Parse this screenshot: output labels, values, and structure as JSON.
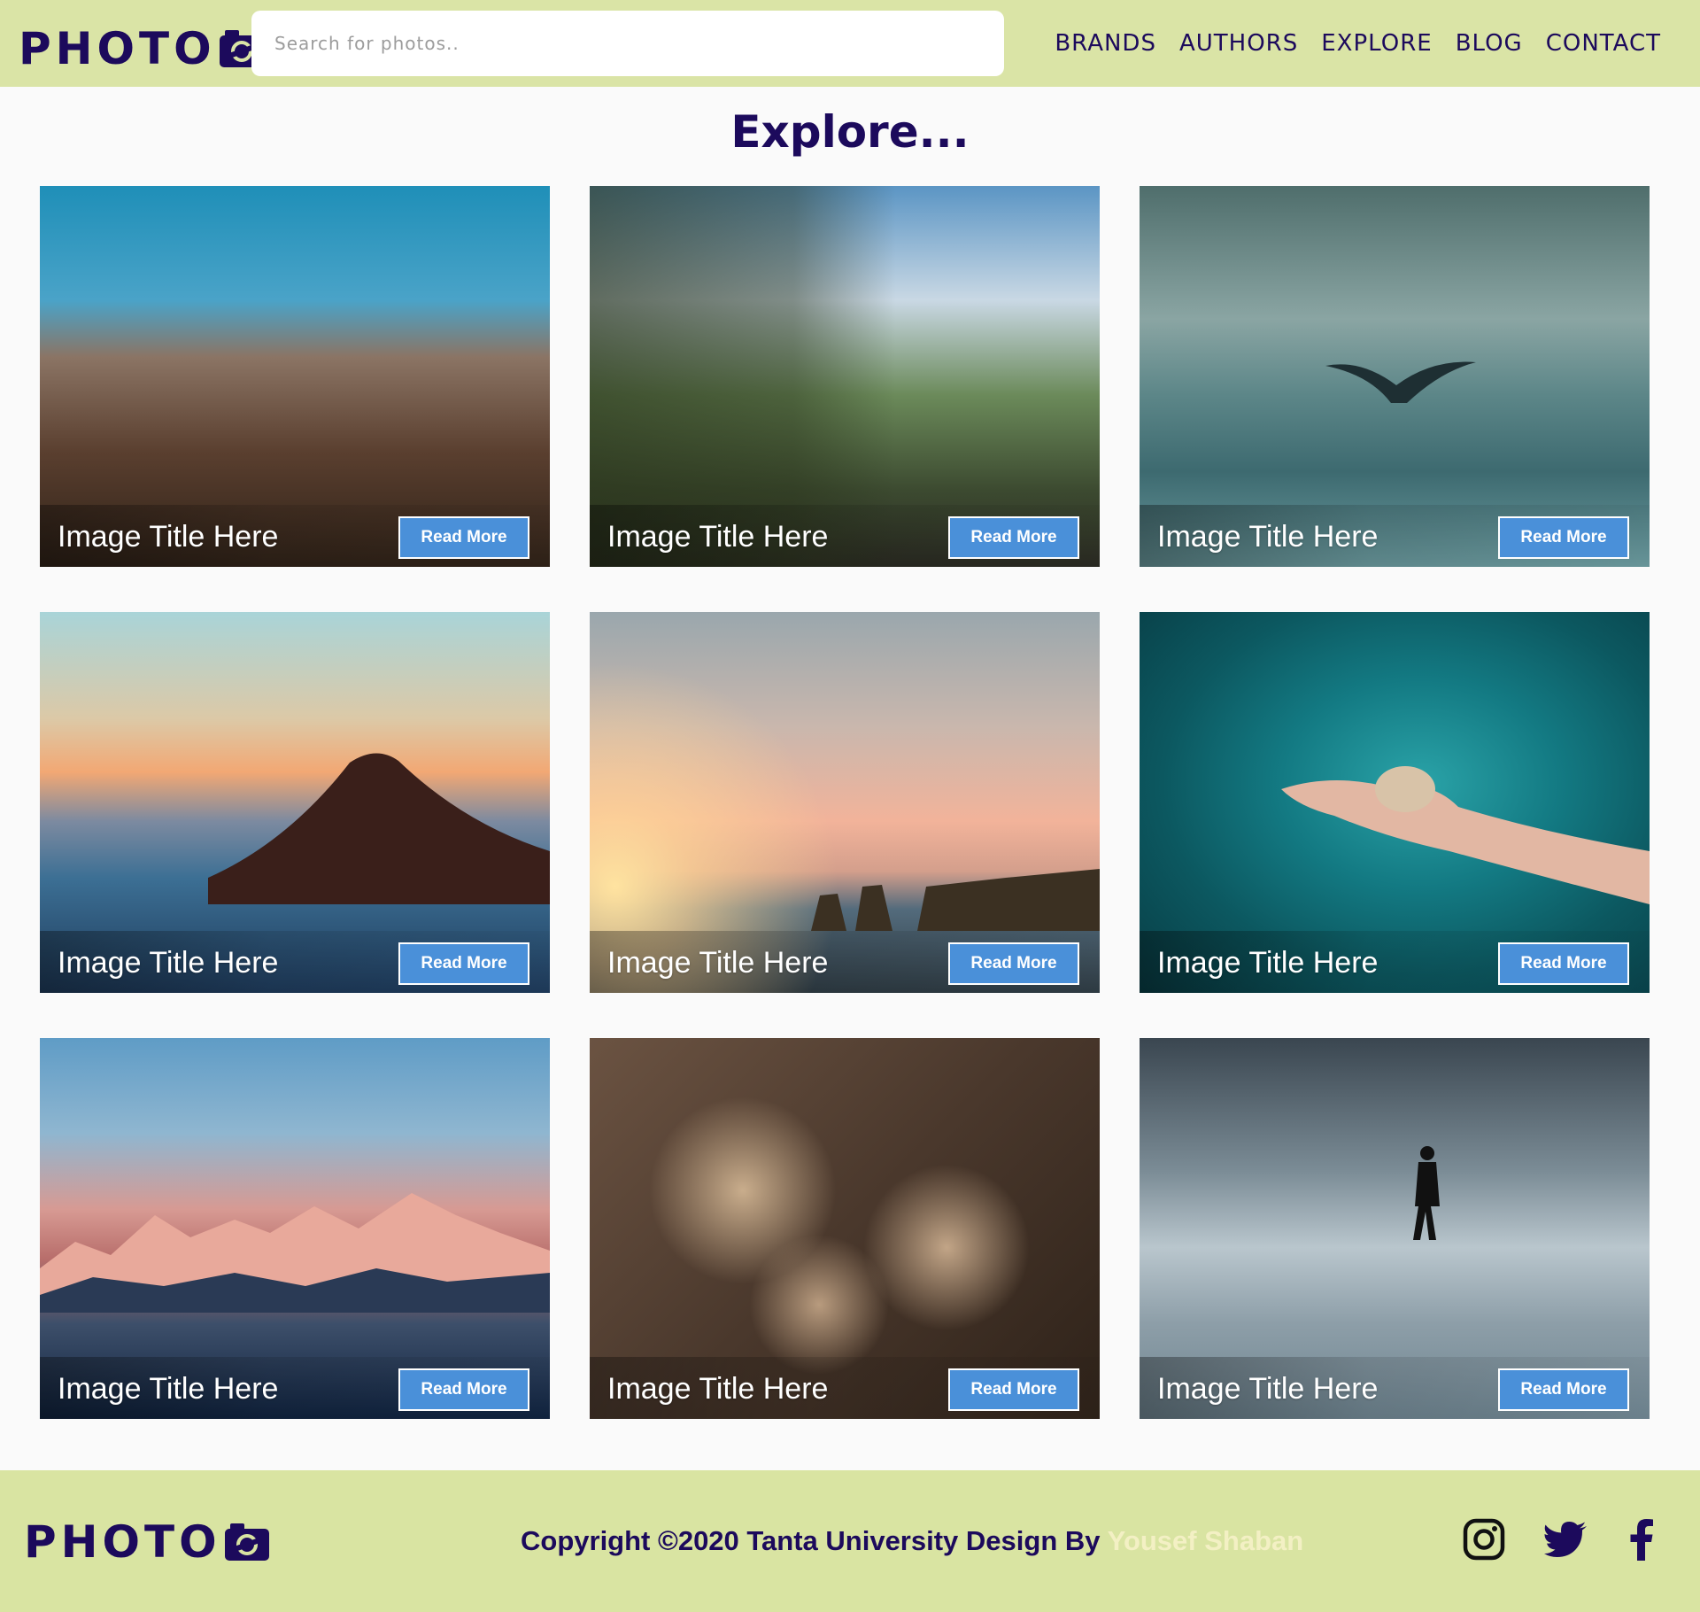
{
  "header": {
    "logo_text": "PHOTO",
    "search_placeholder": "Search for photos..",
    "nav": [
      "BRANDS",
      "AUTHORS",
      "EXPLORE",
      "BLOG",
      "CONTACT"
    ]
  },
  "main": {
    "title": "Explore...",
    "cards": [
      {
        "title": "Image Title Here",
        "button": "Read More",
        "scene": "granite dome mountain under blue sky"
      },
      {
        "title": "Image Title Here",
        "button": "Read More",
        "scene": "tropical limestone karst island and turquoise bay"
      },
      {
        "title": "Image Title Here",
        "button": "Read More",
        "scene": "whale tail above grey ocean"
      },
      {
        "title": "Image Title Here",
        "button": "Read More",
        "scene": "volcano above sea of clouds at sunset"
      },
      {
        "title": "Image Title Here",
        "button": "Read More",
        "scene": "sunset over coastal sea stacks"
      },
      {
        "title": "Image Title Here",
        "button": "Read More",
        "scene": "hand holding seashell in teal water"
      },
      {
        "title": "Image Title Here",
        "button": "Read More",
        "scene": "pink snowy mountain range"
      },
      {
        "title": "Image Title Here",
        "button": "Read More",
        "scene": "dried flowers close-up"
      },
      {
        "title": "Image Title Here",
        "button": "Read More",
        "scene": "person crossing snowy city street"
      }
    ]
  },
  "footer": {
    "logo_text": "PHOTO",
    "copyright": "Copyright ©2020 Tanta University Design By",
    "author": "Yousef Shaban",
    "social": [
      "instagram-icon",
      "twitter-icon",
      "facebook-icon"
    ]
  },
  "colors": {
    "header_bg": "#dae4a6",
    "footer_bg": "#d9e4a2",
    "brand_text": "#1c0a5c",
    "button_bg": "#4a90d9",
    "author_text": "#f3f0c4"
  }
}
